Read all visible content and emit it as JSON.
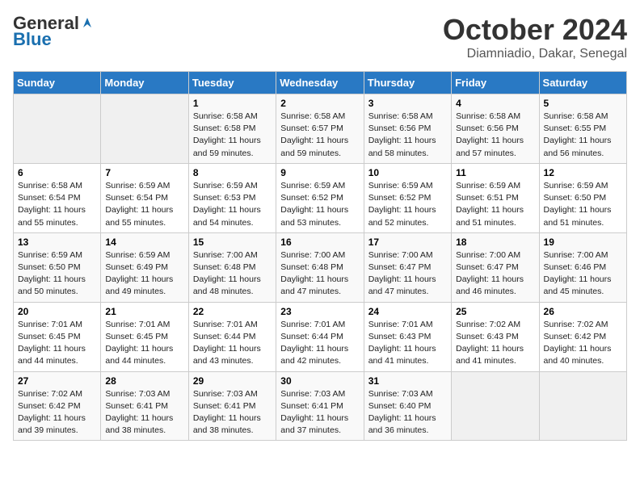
{
  "logo": {
    "general": "General",
    "blue": "Blue"
  },
  "title": "October 2024",
  "subtitle": "Diamniadio, Dakar, Senegal",
  "headers": [
    "Sunday",
    "Monday",
    "Tuesday",
    "Wednesday",
    "Thursday",
    "Friday",
    "Saturday"
  ],
  "weeks": [
    [
      {
        "day": "",
        "info": ""
      },
      {
        "day": "",
        "info": ""
      },
      {
        "day": "1",
        "info": "Sunrise: 6:58 AM\nSunset: 6:58 PM\nDaylight: 11 hours\nand 59 minutes."
      },
      {
        "day": "2",
        "info": "Sunrise: 6:58 AM\nSunset: 6:57 PM\nDaylight: 11 hours\nand 59 minutes."
      },
      {
        "day": "3",
        "info": "Sunrise: 6:58 AM\nSunset: 6:56 PM\nDaylight: 11 hours\nand 58 minutes."
      },
      {
        "day": "4",
        "info": "Sunrise: 6:58 AM\nSunset: 6:56 PM\nDaylight: 11 hours\nand 57 minutes."
      },
      {
        "day": "5",
        "info": "Sunrise: 6:58 AM\nSunset: 6:55 PM\nDaylight: 11 hours\nand 56 minutes."
      }
    ],
    [
      {
        "day": "6",
        "info": "Sunrise: 6:58 AM\nSunset: 6:54 PM\nDaylight: 11 hours\nand 55 minutes."
      },
      {
        "day": "7",
        "info": "Sunrise: 6:59 AM\nSunset: 6:54 PM\nDaylight: 11 hours\nand 55 minutes."
      },
      {
        "day": "8",
        "info": "Sunrise: 6:59 AM\nSunset: 6:53 PM\nDaylight: 11 hours\nand 54 minutes."
      },
      {
        "day": "9",
        "info": "Sunrise: 6:59 AM\nSunset: 6:52 PM\nDaylight: 11 hours\nand 53 minutes."
      },
      {
        "day": "10",
        "info": "Sunrise: 6:59 AM\nSunset: 6:52 PM\nDaylight: 11 hours\nand 52 minutes."
      },
      {
        "day": "11",
        "info": "Sunrise: 6:59 AM\nSunset: 6:51 PM\nDaylight: 11 hours\nand 51 minutes."
      },
      {
        "day": "12",
        "info": "Sunrise: 6:59 AM\nSunset: 6:50 PM\nDaylight: 11 hours\nand 51 minutes."
      }
    ],
    [
      {
        "day": "13",
        "info": "Sunrise: 6:59 AM\nSunset: 6:50 PM\nDaylight: 11 hours\nand 50 minutes."
      },
      {
        "day": "14",
        "info": "Sunrise: 6:59 AM\nSunset: 6:49 PM\nDaylight: 11 hours\nand 49 minutes."
      },
      {
        "day": "15",
        "info": "Sunrise: 7:00 AM\nSunset: 6:48 PM\nDaylight: 11 hours\nand 48 minutes."
      },
      {
        "day": "16",
        "info": "Sunrise: 7:00 AM\nSunset: 6:48 PM\nDaylight: 11 hours\nand 47 minutes."
      },
      {
        "day": "17",
        "info": "Sunrise: 7:00 AM\nSunset: 6:47 PM\nDaylight: 11 hours\nand 47 minutes."
      },
      {
        "day": "18",
        "info": "Sunrise: 7:00 AM\nSunset: 6:47 PM\nDaylight: 11 hours\nand 46 minutes."
      },
      {
        "day": "19",
        "info": "Sunrise: 7:00 AM\nSunset: 6:46 PM\nDaylight: 11 hours\nand 45 minutes."
      }
    ],
    [
      {
        "day": "20",
        "info": "Sunrise: 7:01 AM\nSunset: 6:45 PM\nDaylight: 11 hours\nand 44 minutes."
      },
      {
        "day": "21",
        "info": "Sunrise: 7:01 AM\nSunset: 6:45 PM\nDaylight: 11 hours\nand 44 minutes."
      },
      {
        "day": "22",
        "info": "Sunrise: 7:01 AM\nSunset: 6:44 PM\nDaylight: 11 hours\nand 43 minutes."
      },
      {
        "day": "23",
        "info": "Sunrise: 7:01 AM\nSunset: 6:44 PM\nDaylight: 11 hours\nand 42 minutes."
      },
      {
        "day": "24",
        "info": "Sunrise: 7:01 AM\nSunset: 6:43 PM\nDaylight: 11 hours\nand 41 minutes."
      },
      {
        "day": "25",
        "info": "Sunrise: 7:02 AM\nSunset: 6:43 PM\nDaylight: 11 hours\nand 41 minutes."
      },
      {
        "day": "26",
        "info": "Sunrise: 7:02 AM\nSunset: 6:42 PM\nDaylight: 11 hours\nand 40 minutes."
      }
    ],
    [
      {
        "day": "27",
        "info": "Sunrise: 7:02 AM\nSunset: 6:42 PM\nDaylight: 11 hours\nand 39 minutes."
      },
      {
        "day": "28",
        "info": "Sunrise: 7:03 AM\nSunset: 6:41 PM\nDaylight: 11 hours\nand 38 minutes."
      },
      {
        "day": "29",
        "info": "Sunrise: 7:03 AM\nSunset: 6:41 PM\nDaylight: 11 hours\nand 38 minutes."
      },
      {
        "day": "30",
        "info": "Sunrise: 7:03 AM\nSunset: 6:41 PM\nDaylight: 11 hours\nand 37 minutes."
      },
      {
        "day": "31",
        "info": "Sunrise: 7:03 AM\nSunset: 6:40 PM\nDaylight: 11 hours\nand 36 minutes."
      },
      {
        "day": "",
        "info": ""
      },
      {
        "day": "",
        "info": ""
      }
    ]
  ]
}
